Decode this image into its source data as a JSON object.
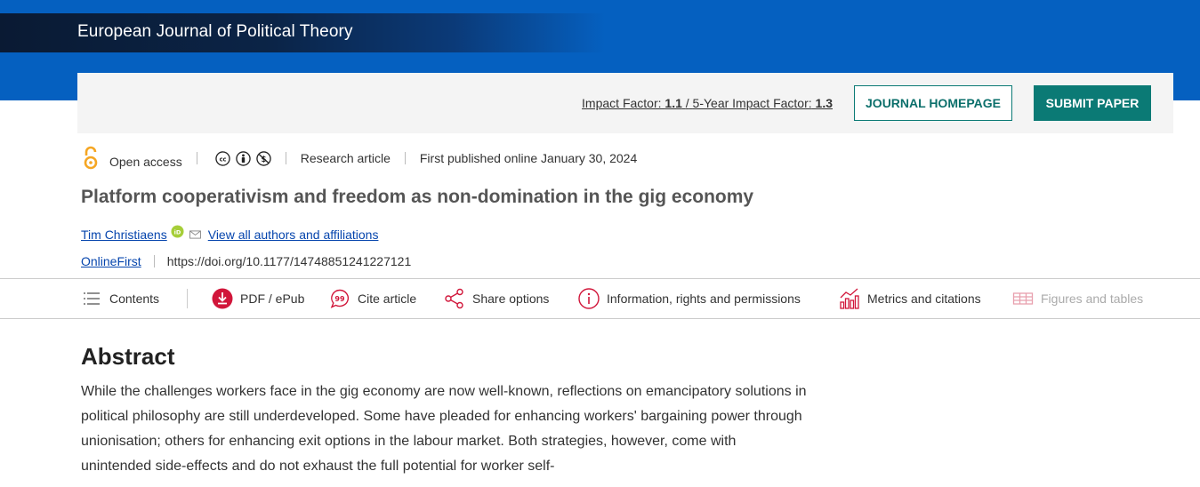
{
  "journal": {
    "title": "European Journal of Political Theory"
  },
  "info_bar": {
    "impact_label": "Impact Factor:",
    "impact_value": "1.1",
    "divider": "/",
    "five_year_label": "5-Year Impact Factor:",
    "five_year_value": "1.3",
    "homepage_button": "JOURNAL HOMEPAGE",
    "submit_button": "SUBMIT PAPER"
  },
  "meta": {
    "access": "Open access",
    "type": "Research article",
    "published": "First published online January 30, 2024"
  },
  "article": {
    "title": "Platform cooperativism and freedom as non-domination in the gig economy",
    "author": "Tim Christiaens",
    "all_authors_link": "View all authors and affiliations",
    "issue": "OnlineFirst",
    "doi": "https://doi.org/10.1177/14748851241227121"
  },
  "toolbar": {
    "contents": "Contents",
    "pdf": "PDF / ePub",
    "cite": "Cite article",
    "share": "Share options",
    "info": "Information, rights and permissions",
    "metrics": "Metrics and citations",
    "figures": "Figures and tables"
  },
  "abstract": {
    "heading": "Abstract",
    "text": "While the challenges workers face in the gig economy are now well-known, reflections on emancipatory solutions in political philosophy are still underdeveloped. Some have pleaded for enhancing workers' bargaining power through unionisation; others for enhancing exit options in the labour market. Both strategies, however, come with unintended side-effects and do not exhaust the full potential for worker self-"
  },
  "colors": {
    "brand_blue": "#0560c0",
    "teal": "#0b7a75",
    "link": "#0645ad",
    "accent_red": "#d1163a",
    "open_access_orange": "#f5a623"
  }
}
